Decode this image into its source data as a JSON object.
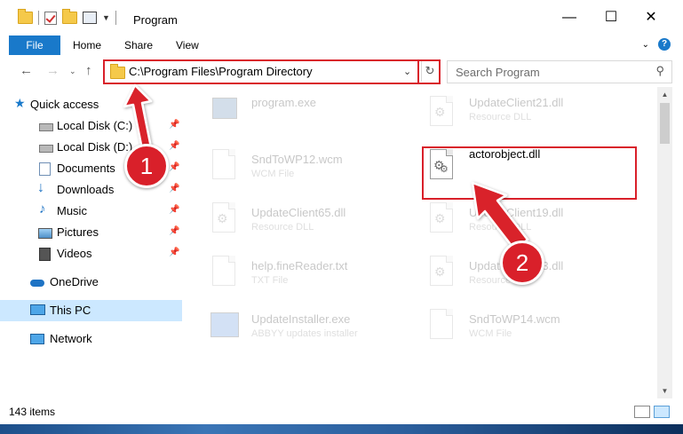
{
  "window": {
    "title": "Program",
    "controls": {
      "minimize": "—",
      "maximize": "☐",
      "close": "✕"
    }
  },
  "ribbon": {
    "file_tab": "File",
    "tabs": [
      "Home",
      "Share",
      "View"
    ]
  },
  "address_bar": {
    "path": "C:\\Program Files\\Program Directory",
    "search_placeholder": "Search Program"
  },
  "sidebar": {
    "items": [
      {
        "label": "Quick access",
        "icon": "star-icon"
      },
      {
        "label": "Local Disk (C:)",
        "icon": "drive-icon"
      },
      {
        "label": "Local Disk (D:)",
        "icon": "drive-icon"
      },
      {
        "label": "Documents",
        "icon": "documents-icon"
      },
      {
        "label": "Downloads",
        "icon": "downloads-icon"
      },
      {
        "label": "Music",
        "icon": "music-icon"
      },
      {
        "label": "Pictures",
        "icon": "pictures-icon"
      },
      {
        "label": "Videos",
        "icon": "videos-icon"
      },
      {
        "label": "OneDrive",
        "icon": "onedrive-icon"
      },
      {
        "label": "This PC",
        "icon": "computer-icon"
      },
      {
        "label": "Network",
        "icon": "network-icon"
      }
    ],
    "selected": "This PC"
  },
  "files": [
    {
      "name": "program.exe",
      "type": ""
    },
    {
      "name": "UpdateClient21.dll",
      "type": "Resource DLL"
    },
    {
      "name": "SndToWP12.wcm",
      "type": "WCM File"
    },
    {
      "name": "actorobject.dll",
      "type": ""
    },
    {
      "name": "UpdateClient65.dll",
      "type": "Resource DLL"
    },
    {
      "name": "UpdateClient19.dll",
      "type": "Resource DLL"
    },
    {
      "name": "help.fineReader.txt",
      "type": "TXT File"
    },
    {
      "name": "UpdateClient63.dll",
      "type": "Resource DLL"
    },
    {
      "name": "UpdateInstaller.exe",
      "type": "ABBYY updates installer"
    },
    {
      "name": "SndToWP14.wcm",
      "type": "WCM File"
    }
  ],
  "status": {
    "item_count": "143 items"
  },
  "callouts": {
    "one": "1",
    "two": "2"
  },
  "colors": {
    "accent": "#1979ca",
    "highlight": "#d9202a",
    "selection": "#cce8ff"
  }
}
